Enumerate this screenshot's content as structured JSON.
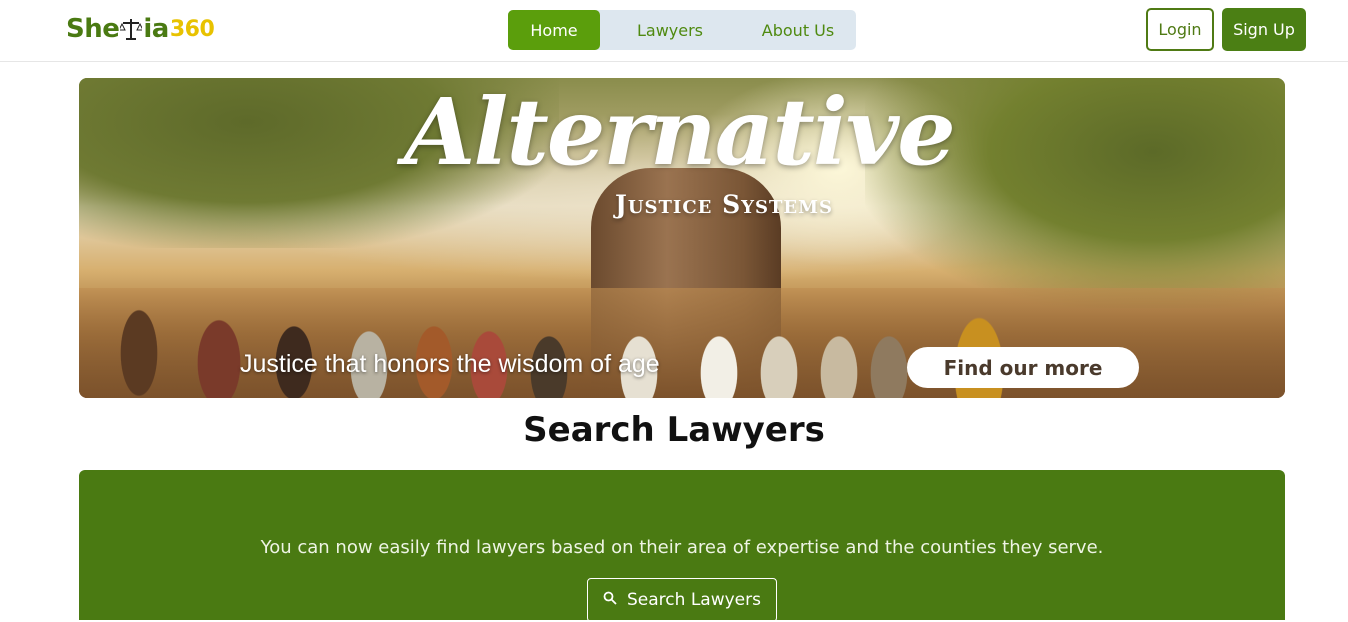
{
  "brand": {
    "part1": "She",
    "part2": "ia",
    "suffix": "360"
  },
  "nav": {
    "items": [
      {
        "label": "Home"
      },
      {
        "label": "Lawyers"
      },
      {
        "label": "About Us"
      }
    ]
  },
  "auth": {
    "login_label": "Login",
    "signup_label": "Sign Up"
  },
  "banner": {
    "title": "Alternative",
    "subtitle": "Justice Systems",
    "tagline": "Justice that honors the wisdom of age",
    "cta_label": "Find our more"
  },
  "search": {
    "heading": "Search Lawyers",
    "description": "You can now easily find lawyers based on their area of expertise and the counties they serve.",
    "button_label": "Search Lawyers"
  },
  "colors": {
    "brand_green": "#4a7a12",
    "nav_active": "#5b9e0c",
    "accent_yellow": "#e8c200"
  },
  "icons": {
    "logo_glyph": "scales-of-justice-icon",
    "search_button_icon": "search-icon"
  }
}
